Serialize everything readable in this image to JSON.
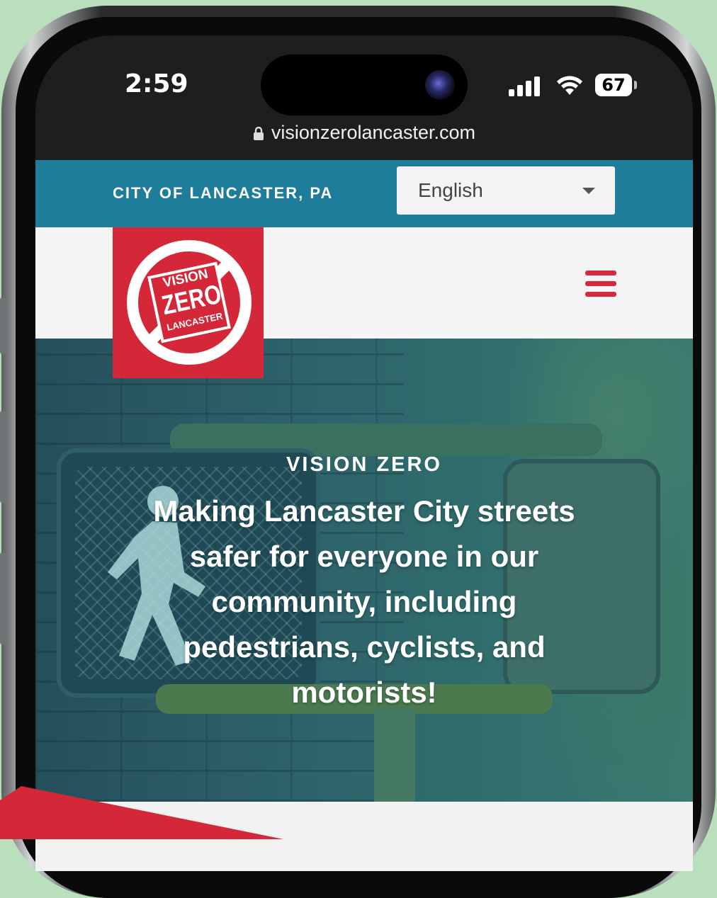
{
  "status_bar": {
    "time": "2:59",
    "battery": "67"
  },
  "browser": {
    "url": "visionzerolancaster.com"
  },
  "topbar": {
    "city": "CITY OF LANCASTER, PA",
    "language_selected": "English"
  },
  "logo": {
    "line1": "VISION",
    "line2": "ZERO",
    "line3": "LANCASTER"
  },
  "hero": {
    "kicker": "VISION ZERO",
    "title": "Making Lancaster City streets safer for everyone in our community, including pedestrians, cyclists, and motorists!"
  },
  "colors": {
    "brand_red": "#d42839",
    "topbar_blue": "#1d7d9b",
    "page_background": "#b9dfbd"
  },
  "icons": [
    "lock-icon",
    "chevron-down-icon",
    "hamburger-menu-icon",
    "cellular-signal-icon",
    "wifi-icon",
    "battery-icon"
  ]
}
